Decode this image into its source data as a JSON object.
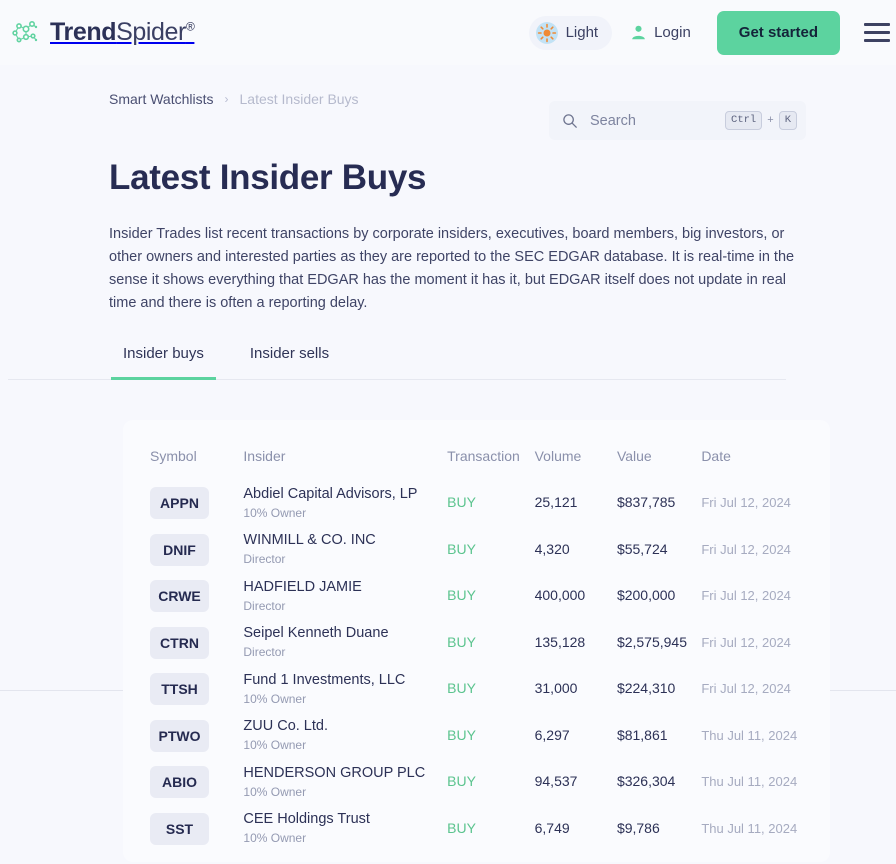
{
  "header": {
    "logo": {
      "icon": "spider-web-icon",
      "bold_part": "Trend",
      "light_part": "Spider",
      "registered": "®"
    },
    "theme_toggle": {
      "label": "Light",
      "icon": "sun-icon"
    },
    "login": {
      "label": "Login",
      "icon": "user-icon"
    },
    "cta": {
      "label": "Get started"
    },
    "menu": {
      "icon": "hamburger-menu-icon"
    }
  },
  "breadcrumb": {
    "parent": "Smart Watchlists",
    "separator": "›",
    "current": "Latest Insider Buys"
  },
  "search": {
    "placeholder": "Search",
    "value": "",
    "icon": "search-icon",
    "shortcut_key1": "Ctrl",
    "shortcut_plus": "+",
    "shortcut_key2": "K"
  },
  "main": {
    "title": "Latest Insider Buys",
    "description": "Insider Trades list recent transactions by corporate insiders, executives, board members, big investors, or other owners and interested parties as they are reported to the SEC EDGAR database. It is real-time in the sense it shows everything that EDGAR has the moment it has it, but EDGAR itself does not update in real time and there is often a reporting delay.",
    "tabs": [
      {
        "label": "Insider buys",
        "active": true
      },
      {
        "label": "Insider sells",
        "active": false
      }
    ]
  },
  "table": {
    "columns": [
      "Symbol",
      "Insider",
      "Transaction",
      "Volume",
      "Value",
      "Date"
    ],
    "rows": [
      {
        "symbol": "APPN",
        "insider": "Abdiel Capital Advisors, LP",
        "role": "10% Owner",
        "transaction": "BUY",
        "volume": "25,121",
        "value": "$837,785",
        "date": "Fri Jul 12, 2024"
      },
      {
        "symbol": "DNIF",
        "insider": "WINMILL & CO. INC",
        "role": "Director",
        "transaction": "BUY",
        "volume": "4,320",
        "value": "$55,724",
        "date": "Fri Jul 12, 2024"
      },
      {
        "symbol": "CRWE",
        "insider": "HADFIELD JAMIE",
        "role": "Director",
        "transaction": "BUY",
        "volume": "400,000",
        "value": "$200,000",
        "date": "Fri Jul 12, 2024"
      },
      {
        "symbol": "CTRN",
        "insider": "Seipel Kenneth Duane",
        "role": "Director",
        "transaction": "BUY",
        "volume": "135,128",
        "value": "$2,575,945",
        "date": "Fri Jul 12, 2024"
      },
      {
        "symbol": "TTSH",
        "insider": "Fund 1 Investments, LLC",
        "role": "10% Owner",
        "transaction": "BUY",
        "volume": "31,000",
        "value": "$224,310",
        "date": "Fri Jul 12, 2024"
      },
      {
        "symbol": "PTWO",
        "insider": "ZUU Co. Ltd.",
        "role": "10% Owner",
        "transaction": "BUY",
        "volume": "6,297",
        "value": "$81,861",
        "date": "Thu Jul 11, 2024"
      },
      {
        "symbol": "ABIO",
        "insider": "HENDERSON GROUP PLC",
        "role": "10% Owner",
        "transaction": "BUY",
        "volume": "94,537",
        "value": "$326,304",
        "date": "Thu Jul 11, 2024"
      },
      {
        "symbol": "SST",
        "insider": "CEE Holdings Trust",
        "role": "10% Owner",
        "transaction": "BUY",
        "volume": "6,749",
        "value": "$9,786",
        "date": "Thu Jul 11, 2024"
      }
    ]
  },
  "colors": {
    "accent_green": "#5cd39f",
    "buy_green": "#5cc48f",
    "page_bg": "#f7f8fd",
    "text_dark": "#272c53",
    "sun_orange": "#f08a35"
  }
}
